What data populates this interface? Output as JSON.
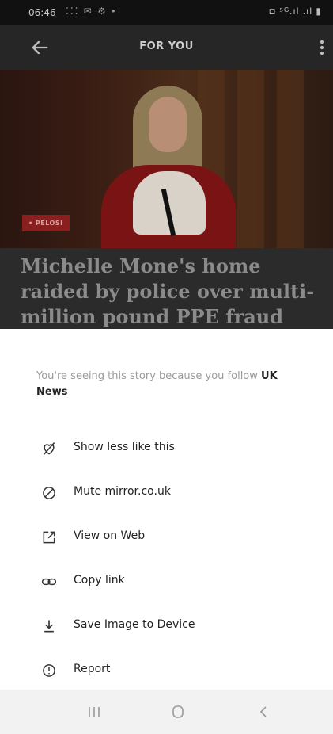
{
  "status_bar": {
    "time": "06:46",
    "left_icons": "⁚⁚⁚ ✉ ⚙ •",
    "right_icons": "◘ ⁵ᴳ.ıl .ıl ▮"
  },
  "app_bar": {
    "title": "FOR YOU",
    "back_icon": "arrow-left-icon",
    "more_icon": "more-vertical-icon"
  },
  "article": {
    "category": "• PELOSI",
    "headline": "Michelle Mone's home raided by police over multi-million pound PPE fraud probe"
  },
  "sheet": {
    "reason_prefix": "You're seeing this story because you follow ",
    "reason_topic": "UK News",
    "items": [
      {
        "label": "Show less like this",
        "icon": "heart-slash-icon"
      },
      {
        "label": "Mute mirror.co.uk",
        "icon": "block-icon"
      },
      {
        "label": "View on Web",
        "icon": "open-external-icon"
      },
      {
        "label": "Copy link",
        "icon": "link-icon"
      },
      {
        "label": "Save Image to Device",
        "icon": "download-icon"
      },
      {
        "label": "Report",
        "icon": "info-icon"
      }
    ]
  },
  "nav_bar": {
    "recents_icon": "recents-icon",
    "home_icon": "home-icon",
    "back_icon": "back-chevron-icon"
  },
  "colors": {
    "dim_background": "#2b2b2b",
    "badge": "#8a1f1f",
    "sheet_text": "#222222",
    "secondary_text": "#9a9a9a",
    "nav_bar": "#f2f2f2"
  }
}
